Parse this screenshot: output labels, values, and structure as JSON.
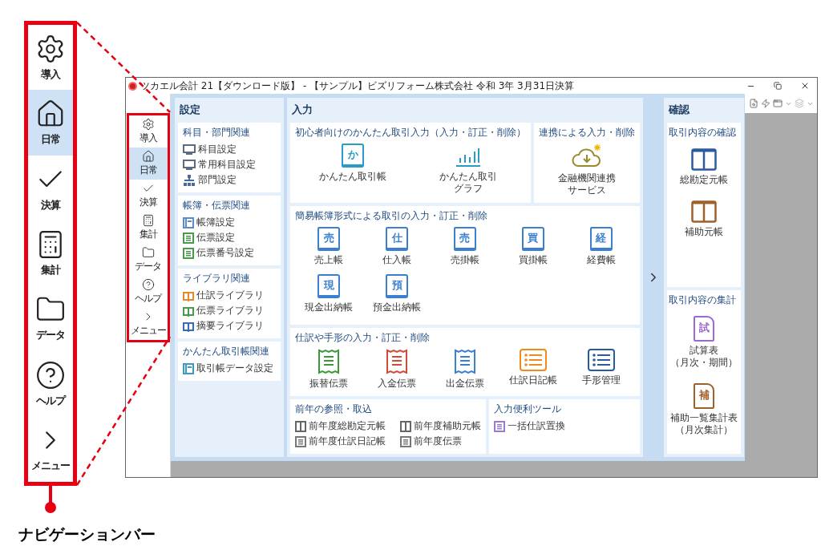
{
  "callout": {
    "items": [
      {
        "label": "導入",
        "selected": false
      },
      {
        "label": "日常",
        "selected": true
      },
      {
        "label": "決算",
        "selected": false
      },
      {
        "label": "集計",
        "selected": false
      },
      {
        "label": "データ",
        "selected": false
      },
      {
        "label": "ヘルプ",
        "selected": false
      },
      {
        "label": "メニュー",
        "selected": false
      }
    ],
    "caption": "ナビゲーションバー"
  },
  "window": {
    "title": "ツカエル会計 21【ダウンロード版】 - 【サンプル】ビズリフォーム株式会社 令和 3年 3月31日決算"
  },
  "nav": {
    "items": [
      {
        "label": "導入",
        "selected": false
      },
      {
        "label": "日常",
        "selected": true
      },
      {
        "label": "決算",
        "selected": false
      },
      {
        "label": "集計",
        "selected": false
      },
      {
        "label": "データ",
        "selected": false
      },
      {
        "label": "ヘルプ",
        "selected": false
      },
      {
        "label": "メニュー",
        "selected": false
      }
    ]
  },
  "settings": {
    "title": "設定",
    "groups": [
      {
        "title": "科目・部門関連",
        "items": [
          {
            "label": "科目設定",
            "kind": "monitor",
            "color": "#5b6b80"
          },
          {
            "label": "常用科目設定",
            "kind": "monitor",
            "color": "#5b6b80"
          },
          {
            "label": "部門設定",
            "kind": "tree",
            "color": "#4a6a9a"
          }
        ]
      },
      {
        "title": "帳簿・伝票関連",
        "items": [
          {
            "label": "帳簿設定",
            "kind": "form",
            "color": "#5a8ac8"
          },
          {
            "label": "伝票設定",
            "kind": "listdoc",
            "color": "#4a9a4a"
          },
          {
            "label": "伝票番号設定",
            "kind": "listdoc",
            "color": "#4a9a4a"
          }
        ]
      },
      {
        "title": "ライブラリ関連",
        "items": [
          {
            "label": "仕訳ライブラリ",
            "kind": "book",
            "color": "#e8882a"
          },
          {
            "label": "伝票ライブラリ",
            "kind": "book",
            "color": "#4a9a4a"
          },
          {
            "label": "摘要ライブラリ",
            "kind": "book",
            "color": "#3a6ab0"
          }
        ]
      },
      {
        "title": "かんたん取引帳関連",
        "items": [
          {
            "label": "取引帳データ設定",
            "kind": "form",
            "color": "#3a9ac0"
          }
        ]
      }
    ]
  },
  "input": {
    "title": "入力",
    "rows": [
      [
        {
          "title": "初心者向けのかんたん取引入力（入力・訂正・削除）",
          "kind": "tiles",
          "items": [
            {
              "lines": [
                "かんたん取引帳"
              ],
              "kind": "book",
              "glyph": "か",
              "color": "#2a9bc4"
            },
            {
              "lines": [
                "かんたん取引",
                "グラフ"
              ],
              "kind": "chart",
              "color": "#2a9bc4"
            }
          ]
        },
        {
          "title": "連携による入力・削除",
          "kind": "tiles",
          "items": [
            {
              "lines": [
                "金融機関連携",
                "サービス"
              ],
              "kind": "cloud",
              "color": "#9a8a2a"
            }
          ]
        }
      ],
      [
        {
          "title": "簡易帳簿形式による取引の入力・訂正・削除",
          "kind": "tiles",
          "items": [
            {
              "lines": [
                "売上帳"
              ],
              "kind": "book",
              "glyph": "売",
              "color": "#3a7fd0"
            },
            {
              "lines": [
                "仕入帳"
              ],
              "kind": "book",
              "glyph": "仕",
              "color": "#3a7fd0"
            },
            {
              "lines": [
                "売掛帳"
              ],
              "kind": "book",
              "glyph": "売",
              "color": "#3a7fd0"
            },
            {
              "lines": [
                "買掛帳"
              ],
              "kind": "book",
              "glyph": "買",
              "color": "#3a7fd0"
            },
            {
              "lines": [
                "経費帳"
              ],
              "kind": "book",
              "glyph": "経",
              "color": "#3a7fd0"
            },
            {
              "lines": [
                "現金出納帳"
              ],
              "kind": "book",
              "glyph": "現",
              "color": "#3a7fd0"
            },
            {
              "lines": [
                "預金出納帳"
              ],
              "kind": "book",
              "glyph": "預",
              "color": "#3a7fd0"
            }
          ]
        }
      ],
      [
        {
          "title": "仕訳や手形の入力・訂正・削除",
          "kind": "tiles",
          "items": [
            {
              "lines": [
                "振替伝票"
              ],
              "kind": "slip",
              "color": "#3a9a3a"
            },
            {
              "lines": [
                "入金伝票"
              ],
              "kind": "slip",
              "color": "#d04a3a"
            },
            {
              "lines": [
                "出金伝票"
              ],
              "kind": "slip",
              "color": "#3a7fd0"
            },
            {
              "lines": [
                "仕訳日記帳"
              ],
              "kind": "list",
              "color": "#f08a1a"
            },
            {
              "lines": [
                "手形管理"
              ],
              "kind": "list",
              "color": "#2a5aa0"
            }
          ]
        }
      ],
      [
        {
          "title": "前年の参照・取込",
          "kind": "list",
          "items": [
            {
              "label": "前年度総勘定元帳",
              "kind": "ledger",
              "color": "#666666"
            },
            {
              "label": "前年度補助元帳",
              "kind": "ledger",
              "color": "#666666"
            },
            {
              "label": "前年度仕訳日記帳",
              "kind": "listdoc",
              "color": "#777777"
            },
            {
              "label": "前年度伝票",
              "kind": "listdoc",
              "color": "#777777"
            }
          ]
        },
        {
          "title": "入力便利ツール",
          "kind": "list",
          "items": [
            {
              "label": "一括仕訳置換",
              "kind": "listdoc",
              "color": "#9a7ad0"
            }
          ]
        }
      ]
    ]
  },
  "confirm": {
    "title": "確認",
    "sections": [
      {
        "title": "取引内容の確認",
        "items": [
          {
            "lines": [
              "総勘定元帳"
            ],
            "kind": "ledger",
            "color": "#2a5aa0"
          },
          {
            "lines": [
              "補助元帳"
            ],
            "kind": "ledger",
            "color": "#a0602a"
          }
        ]
      },
      {
        "title": "取引内容の集計",
        "items": [
          {
            "lines": [
              "試算表",
              "（月次・期間）"
            ],
            "kind": "page",
            "glyph": "試",
            "color": "#9a6ad0"
          },
          {
            "lines": [
              "補助一覧集計表",
              "（月次集計）"
            ],
            "kind": "page",
            "glyph": "補",
            "color": "#a0602a"
          }
        ]
      }
    ]
  }
}
